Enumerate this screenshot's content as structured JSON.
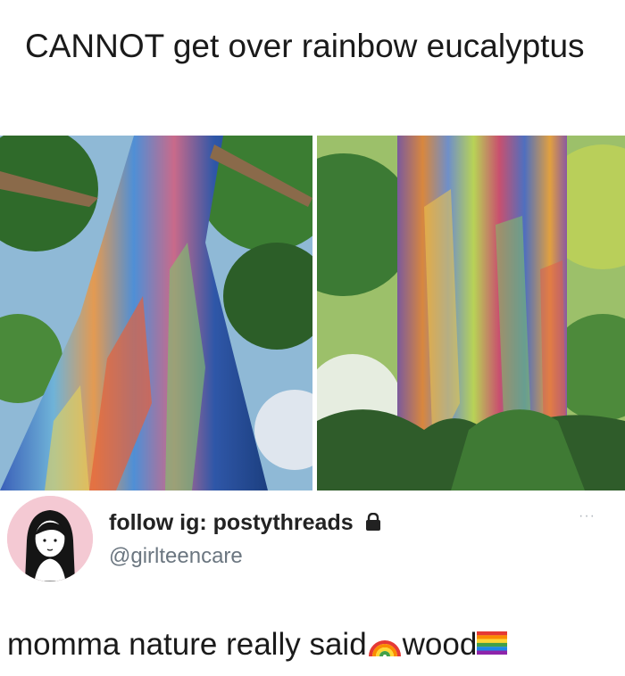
{
  "caption": "CANNOT get over rainbow eucalyptus",
  "images": [
    {
      "name": "rainbow-eucalyptus-photo-left"
    },
    {
      "name": "rainbow-eucalyptus-photo-right"
    }
  ],
  "tweet": {
    "display_name": "follow ig: postythreads",
    "handle": "@girlteencare",
    "more_label": "···",
    "text_part1": "momma nature really said ",
    "text_part2": "wood",
    "icons": [
      "lock-icon",
      "rainbow-emoji",
      "rainbow-flag-emoji"
    ],
    "avatar_bg": "#f4c9d3"
  }
}
